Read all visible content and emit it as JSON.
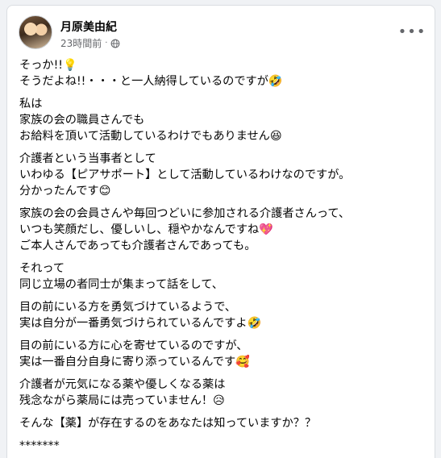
{
  "post": {
    "author": "月原美由紀",
    "time": "23時間前",
    "separator": "·",
    "privacy_icon": "globe-icon",
    "more_icon": "more-horizontal-icon",
    "paragraphs": [
      [
        "そっか!!💡",
        "そうだよね!!・・・と一人納得しているのですが🤣"
      ],
      [
        "私は",
        "家族の会の職員さんでも",
        "お給料を頂いて活動しているわけでもありません😆"
      ],
      [
        "介護者という当事者として",
        "いわゆる【ピアサポート】として活動しているわけなのですが。",
        "分かったんです😊"
      ],
      [
        "家族の会の会員さんや毎回つどいに参加される介護者さんって、",
        "いつも笑顔だし、優しいし、穏やかなんですね💖",
        "ご本人さんであっても介護者さんであっても。"
      ],
      [
        "それって",
        "同じ立場の者同士が集まって話をして、"
      ],
      [
        "目の前にいる方を勇気づけているようで、",
        "実は自分が一番勇気づけられているんですよ🤣"
      ],
      [
        "目の前にいる方に心を寄せているのですが、",
        "実は一番自分自身に寄り添っているんです🥰"
      ],
      [
        "介護者が元気になる薬や優しくなる薬は",
        "残念ながら薬局には売っていません！😥"
      ],
      [
        "そんな【薬】が存在するのをあなたは知っていますか？？"
      ],
      [
        "*******"
      ]
    ]
  },
  "colors": {
    "text": "#050505",
    "meta": "#65676b",
    "background": "#f0f2f5",
    "card": "#ffffff"
  }
}
